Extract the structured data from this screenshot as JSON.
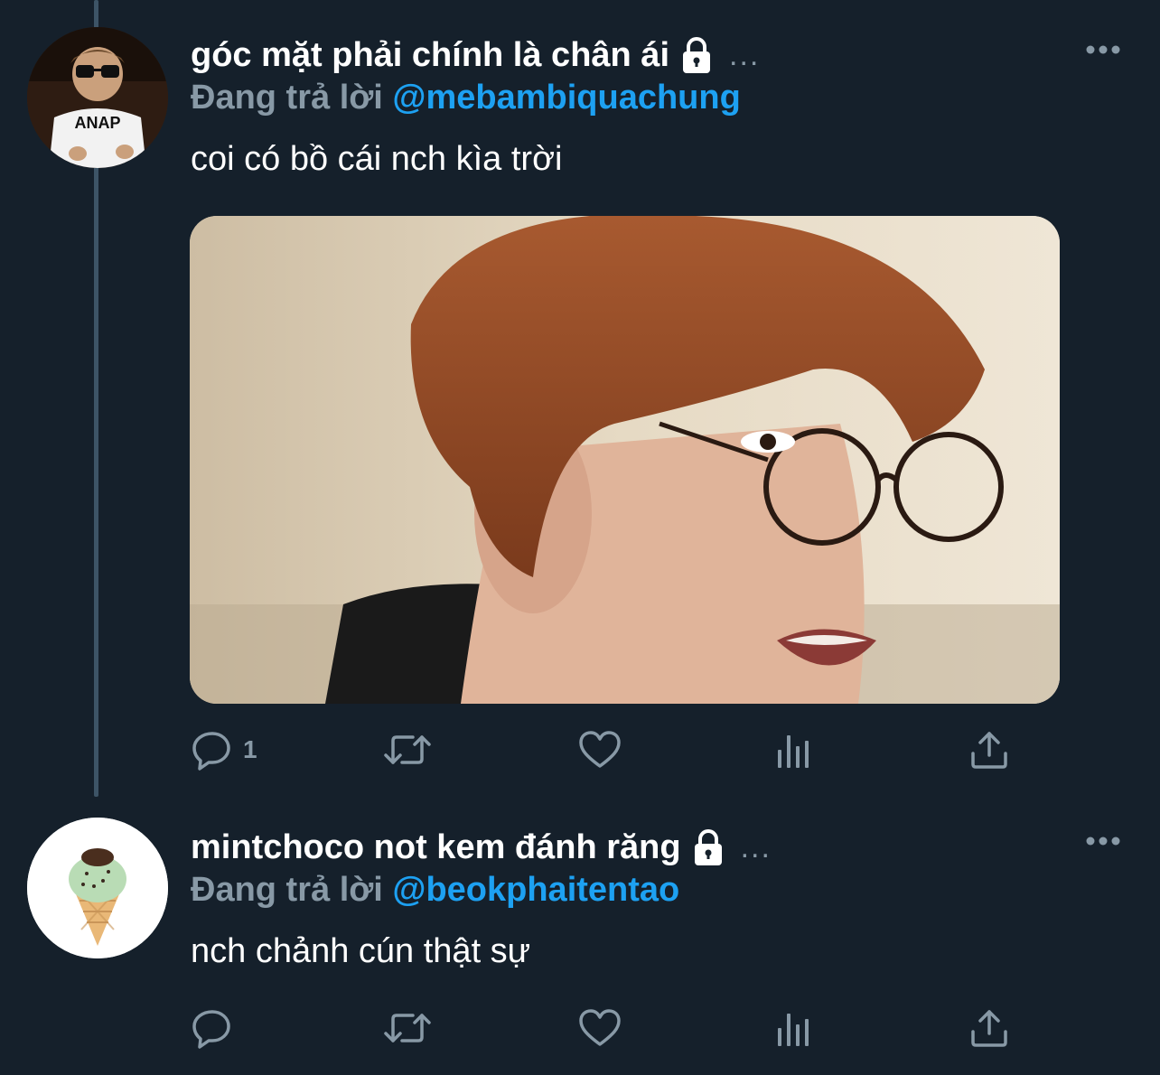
{
  "tweets": [
    {
      "display_name": "góc mặt phải chính là chân ái",
      "protected_icon": "lock-icon",
      "truncation": "...",
      "reply_prefix": "Đang trả lời",
      "reply_handle": "@mebambiquachung",
      "text": "coi có bồ cái nch kìa trời",
      "has_media": true,
      "actions": {
        "reply_count": "1",
        "retweet_count": "",
        "like_count": ""
      }
    },
    {
      "display_name": "mintchoco not kem đánh răng",
      "protected_icon": "lock-icon",
      "truncation": "...",
      "reply_prefix": "Đang trả lời",
      "reply_handle": "@beokphaitentao",
      "text": "nch chảnh cún thật sự",
      "has_media": false,
      "actions": {
        "reply_count": "",
        "retweet_count": "",
        "like_count": ""
      }
    }
  ],
  "avatar1_shirt_text": "ANAP",
  "colors": {
    "background": "#15202b",
    "text_primary": "#ffffff",
    "text_secondary": "#8899a6",
    "accent": "#1da1f2",
    "thread_line": "#3d5466"
  },
  "icons": [
    "reply-icon",
    "retweet-icon",
    "like-icon",
    "analytics-icon",
    "share-icon",
    "more-icon",
    "lock-icon"
  ]
}
